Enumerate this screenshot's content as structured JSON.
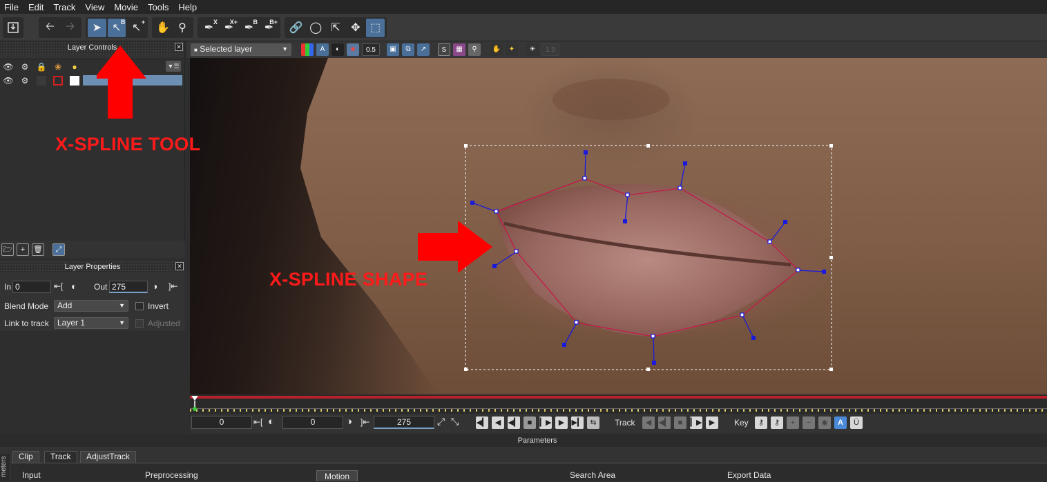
{
  "menu": [
    "File",
    "Edit",
    "Track",
    "View",
    "Movie",
    "Tools",
    "Help"
  ],
  "layer_controls": {
    "title": "Layer Controls"
  },
  "layer_properties": {
    "title": "Layer Properties",
    "in_label": "In",
    "in_value": "0",
    "out_label": "Out",
    "out_value": "275",
    "blend_label": "Blend Mode",
    "blend_value": "Add",
    "invert_label": "Invert",
    "link_label": "Link to track",
    "link_value": "Layer 1",
    "adjusted_label": "Adjusted"
  },
  "viewer_bar": {
    "layer_select": "Selected layer",
    "opacity": "0.5",
    "exposure": "1.0"
  },
  "toolbar": {
    "x_label": "X",
    "xplus_label": "X+",
    "b_label": "B",
    "bplus_label": "B+"
  },
  "annotations": {
    "tool": "X-SPLINE TOOL",
    "shape": "X-SPLINE SHAPE"
  },
  "transport": {
    "start": "0",
    "current": "0",
    "end": "275",
    "track_label": "Track",
    "key_label": "Key"
  },
  "parameters": {
    "title": "Parameters",
    "side_label": "meters",
    "tabs": [
      "Clip",
      "Track",
      "AdjustTrack"
    ],
    "sections": [
      "Input",
      "Preprocessing",
      "Motion",
      "Search Area",
      "Export Data"
    ]
  },
  "colors": {
    "accent": "#4a6f99",
    "annotation": "#ff1a1a",
    "spline": "#c4184a",
    "handle": "#1a1adc"
  }
}
